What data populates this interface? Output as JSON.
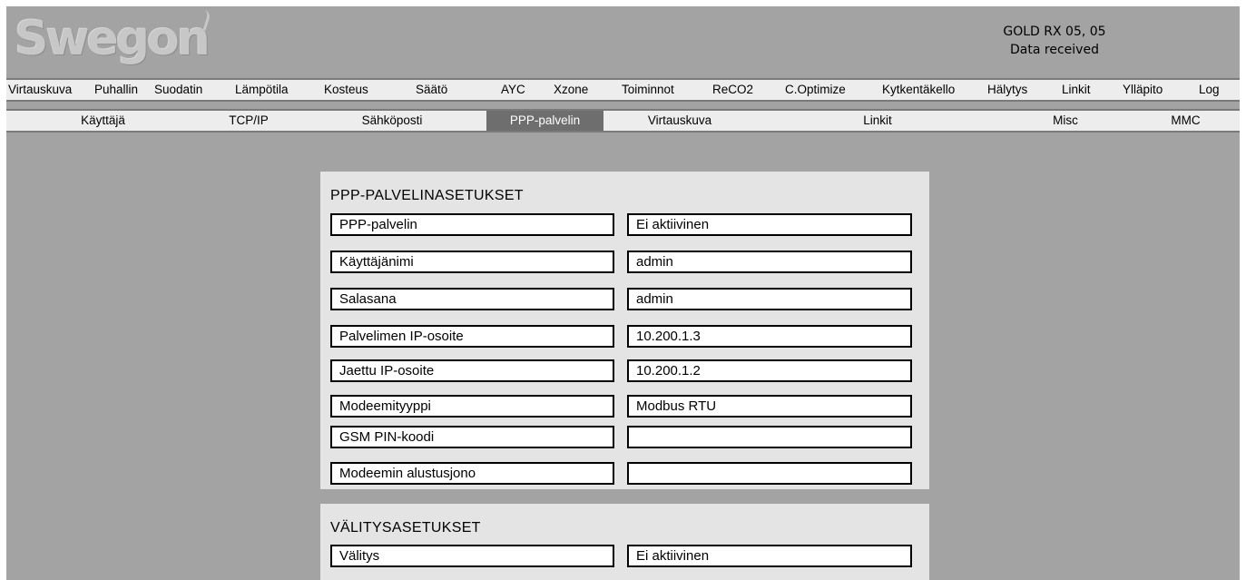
{
  "header": {
    "logo_text": "Swegon",
    "device_name": "GOLD RX 05, 05",
    "status": "Data received"
  },
  "main_nav": [
    {
      "label": "Virtauskuva"
    },
    {
      "label": "Puhallin"
    },
    {
      "label": "Suodatin"
    },
    {
      "label": "Lämpötila"
    },
    {
      "label": "Kosteus"
    },
    {
      "label": "Säätö"
    },
    {
      "label": "AYC"
    },
    {
      "label": "Xzone"
    },
    {
      "label": "Toiminnot"
    },
    {
      "label": "ReCO2"
    },
    {
      "label": "C.Optimize"
    },
    {
      "label": "Kytkentäkello"
    },
    {
      "label": "Hälytys"
    },
    {
      "label": "Linkit"
    },
    {
      "label": "Ylläpito"
    },
    {
      "label": "Log"
    }
  ],
  "sub_nav": [
    {
      "label": "Käyttäjä",
      "active": false
    },
    {
      "label": "TCP/IP",
      "active": false
    },
    {
      "label": "Sähköposti",
      "active": false
    },
    {
      "label": "PPP-palvelin",
      "active": true
    },
    {
      "label": "Virtauskuva",
      "active": false
    },
    {
      "label": "Linkit",
      "active": false
    },
    {
      "label": "Misc",
      "active": false
    },
    {
      "label": "MMC",
      "active": false
    }
  ],
  "ppp_section": {
    "title": "PPP-PALVELINASETUKSET",
    "rows": [
      {
        "label": "PPP-palvelin",
        "value": "Ei aktiivinen"
      },
      {
        "label": "Käyttäjänimi",
        "value": "admin"
      },
      {
        "label": "Salasana",
        "value": "admin"
      },
      {
        "label": "Palvelimen IP-osoite",
        "value": "10.200.1.3"
      },
      {
        "label": "Jaettu IP-osoite",
        "value": "10.200.1.2"
      },
      {
        "label": "Modeemityyppi",
        "value": "Modbus RTU"
      },
      {
        "label": "GSM PIN-koodi",
        "value": ""
      },
      {
        "label": "Modeemin alustusjono",
        "value": ""
      }
    ]
  },
  "relay_section": {
    "title": "VÄLITYSASETUKSET",
    "rows": [
      {
        "label": "Välitys",
        "value": "Ei aktiivinen"
      }
    ]
  }
}
